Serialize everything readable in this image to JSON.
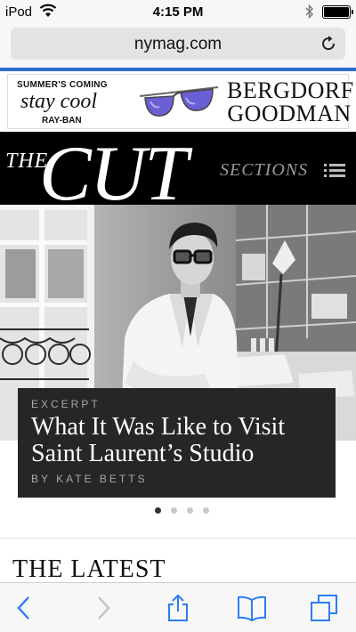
{
  "status_bar": {
    "carrier": "iPod",
    "time": "4:15 PM"
  },
  "browser": {
    "url": "nymag.com"
  },
  "ad": {
    "line1": "SUMMER'S COMING",
    "line2": "stay cool",
    "line3": "RAY-BAN",
    "brand_line1": "BERGDORF",
    "brand_line2": "GOODMAN"
  },
  "header": {
    "logo_the": "THE",
    "logo_cut": "CUT",
    "sections_label": "SECTIONS"
  },
  "hero": {
    "kicker": "EXCERPT",
    "headline": "What It Was Like to Visit Saint Laurent’s Studio",
    "byline": "BY KATE BETTS",
    "slide_count": 4,
    "active_slide": 1
  },
  "section_heading": "THE LATEST",
  "colors": {
    "progress_bar": "#2b6fd3",
    "toolbar_icon": "#2b7cf6",
    "toolbar_icon_disabled": "#c2c2c2",
    "header_bg": "#000000",
    "caption_bg": "#262626"
  },
  "toolbar": {
    "icons": [
      "back-icon",
      "forward-icon",
      "share-icon",
      "bookmarks-icon",
      "tabs-icon"
    ]
  }
}
